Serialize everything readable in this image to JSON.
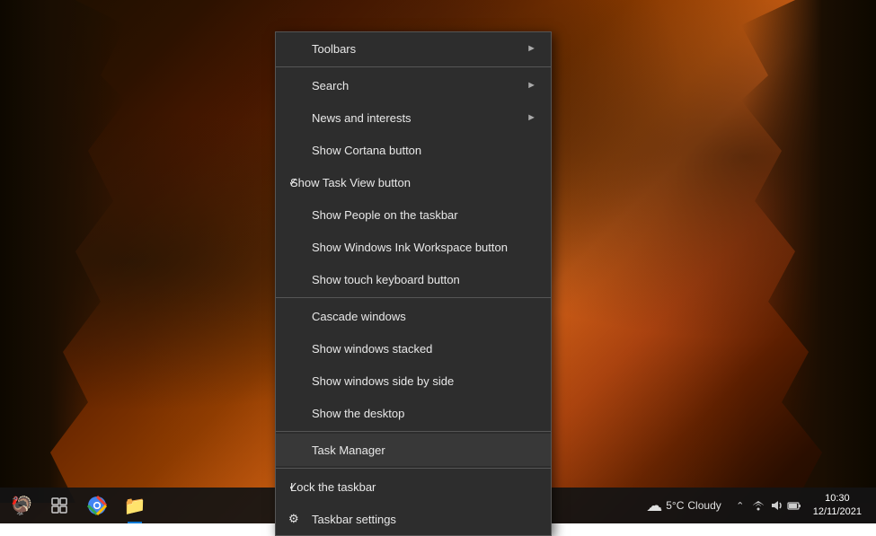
{
  "desktop": {
    "background": "autumn forest"
  },
  "contextMenu": {
    "items": [
      {
        "id": "toolbars",
        "label": "Toolbars",
        "hasArrow": true,
        "hasCheck": false,
        "checkVisible": false,
        "dividerAfter": false
      },
      {
        "id": "divider1",
        "type": "divider"
      },
      {
        "id": "search",
        "label": "Search",
        "hasArrow": true,
        "hasCheck": false,
        "checkVisible": false,
        "dividerAfter": false
      },
      {
        "id": "news",
        "label": "News and interests",
        "hasArrow": true,
        "hasCheck": false,
        "checkVisible": false,
        "dividerAfter": false
      },
      {
        "id": "cortana",
        "label": "Show Cortana button",
        "hasArrow": false,
        "hasCheck": false,
        "checkVisible": false,
        "dividerAfter": false
      },
      {
        "id": "taskview",
        "label": "Show Task View button",
        "hasArrow": false,
        "hasCheck": true,
        "checkVisible": true,
        "dividerAfter": false
      },
      {
        "id": "people",
        "label": "Show People on the taskbar",
        "hasArrow": false,
        "hasCheck": false,
        "checkVisible": false,
        "dividerAfter": false
      },
      {
        "id": "ink",
        "label": "Show Windows Ink Workspace button",
        "hasArrow": false,
        "hasCheck": false,
        "checkVisible": false,
        "dividerAfter": false
      },
      {
        "id": "touch",
        "label": "Show touch keyboard button",
        "hasArrow": false,
        "hasCheck": false,
        "checkVisible": false,
        "dividerAfter": false
      },
      {
        "id": "divider2",
        "type": "divider"
      },
      {
        "id": "cascade",
        "label": "Cascade windows",
        "hasArrow": false,
        "hasCheck": false,
        "checkVisible": false,
        "dividerAfter": false
      },
      {
        "id": "stacked",
        "label": "Show windows stacked",
        "hasArrow": false,
        "hasCheck": false,
        "checkVisible": false,
        "dividerAfter": false
      },
      {
        "id": "sidebyside",
        "label": "Show windows side by side",
        "hasArrow": false,
        "hasCheck": false,
        "checkVisible": false,
        "dividerAfter": false
      },
      {
        "id": "desktop",
        "label": "Show the desktop",
        "hasArrow": false,
        "hasCheck": false,
        "checkVisible": false,
        "dividerAfter": false
      },
      {
        "id": "divider3",
        "type": "divider"
      },
      {
        "id": "taskmanager",
        "label": "Task Manager",
        "hasArrow": false,
        "hasCheck": false,
        "checkVisible": false,
        "highlighted": true,
        "dividerAfter": false
      },
      {
        "id": "divider4",
        "type": "divider"
      },
      {
        "id": "locktaskbar",
        "label": "Lock the taskbar",
        "hasArrow": false,
        "hasCheck": true,
        "checkVisible": true,
        "dividerAfter": false
      },
      {
        "id": "taskbarsettings",
        "label": "Taskbar settings",
        "hasArrow": false,
        "hasCheck": false,
        "checkVisible": false,
        "hasGear": true,
        "dividerAfter": false
      }
    ]
  },
  "taskbar": {
    "icons": [
      {
        "id": "emoji",
        "symbol": "🦃",
        "active": false
      },
      {
        "id": "taskview",
        "symbol": "⧉",
        "active": false
      },
      {
        "id": "chrome",
        "symbol": "⬤",
        "color": "#4285f4",
        "active": false
      },
      {
        "id": "folder",
        "symbol": "📁",
        "active": true
      }
    ],
    "weather": {
      "icon": "☁",
      "temp": "5°C",
      "condition": "Cloudy"
    },
    "tray": {
      "icons": [
        "∧",
        "🔊",
        "🌐",
        "⚡"
      ]
    },
    "clock": {
      "time": "10:30",
      "date": "12/11/2021"
    }
  }
}
